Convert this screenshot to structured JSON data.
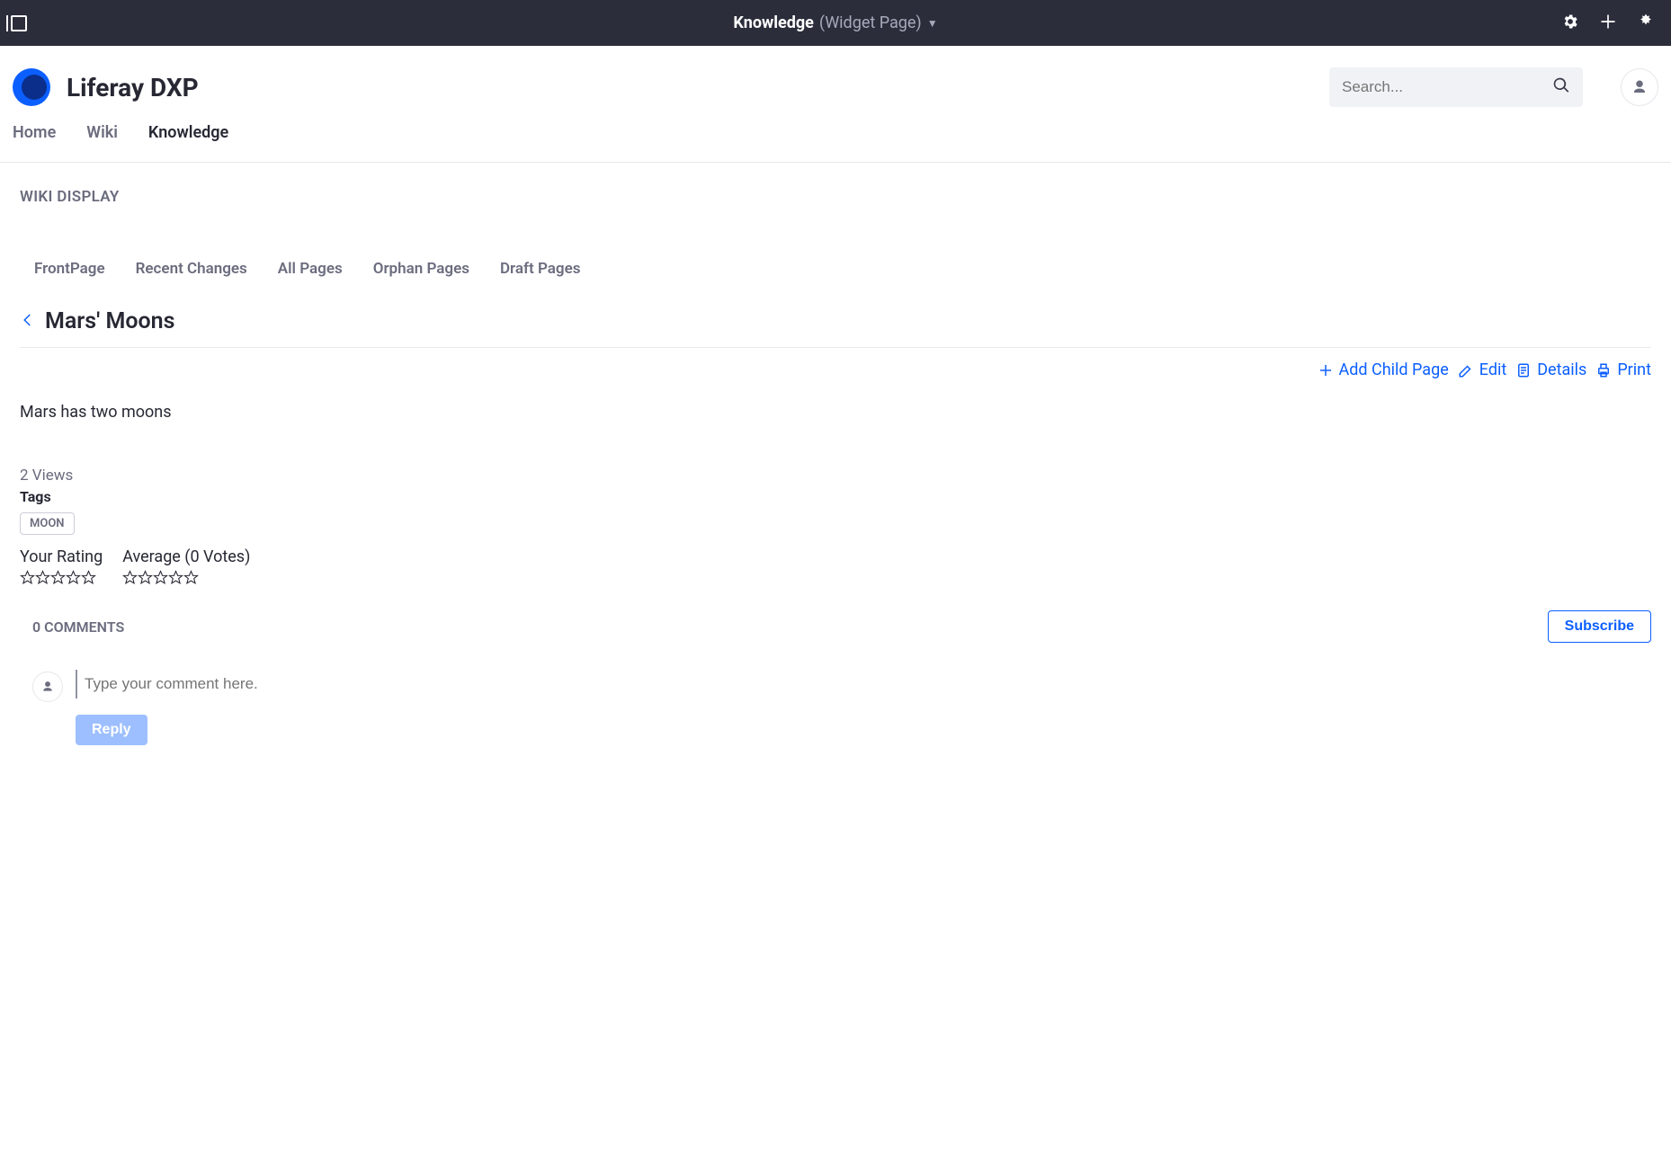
{
  "admin_bar": {
    "title_bold": "Knowledge",
    "title_sub": "(Widget Page)"
  },
  "site": {
    "title": "Liferay DXP",
    "search_placeholder": "Search...",
    "nav": [
      {
        "label": "Home",
        "active": false
      },
      {
        "label": "Wiki",
        "active": false
      },
      {
        "label": "Knowledge",
        "active": true
      }
    ]
  },
  "portlet_title": "WIKI DISPLAY",
  "wiki_tabs": [
    {
      "label": "FrontPage"
    },
    {
      "label": "Recent Changes"
    },
    {
      "label": "All Pages"
    },
    {
      "label": "Orphan Pages"
    },
    {
      "label": "Draft Pages"
    }
  ],
  "page": {
    "title": "Mars' Moons",
    "body": "Mars has two moons",
    "views_text": "2 Views",
    "tags_label": "Tags",
    "tags": [
      "MOON"
    ],
    "actions": {
      "add_child": "Add Child Page",
      "edit": "Edit",
      "details": "Details",
      "print": "Print"
    }
  },
  "ratings": {
    "your_label": "Your Rating",
    "average_label": "Average (0 Votes)",
    "your_value": 0,
    "average_value": 0
  },
  "comments": {
    "count_label": "0 COMMENTS",
    "subscribe_label": "Subscribe",
    "placeholder": "Type your comment here.",
    "reply_label": "Reply"
  }
}
